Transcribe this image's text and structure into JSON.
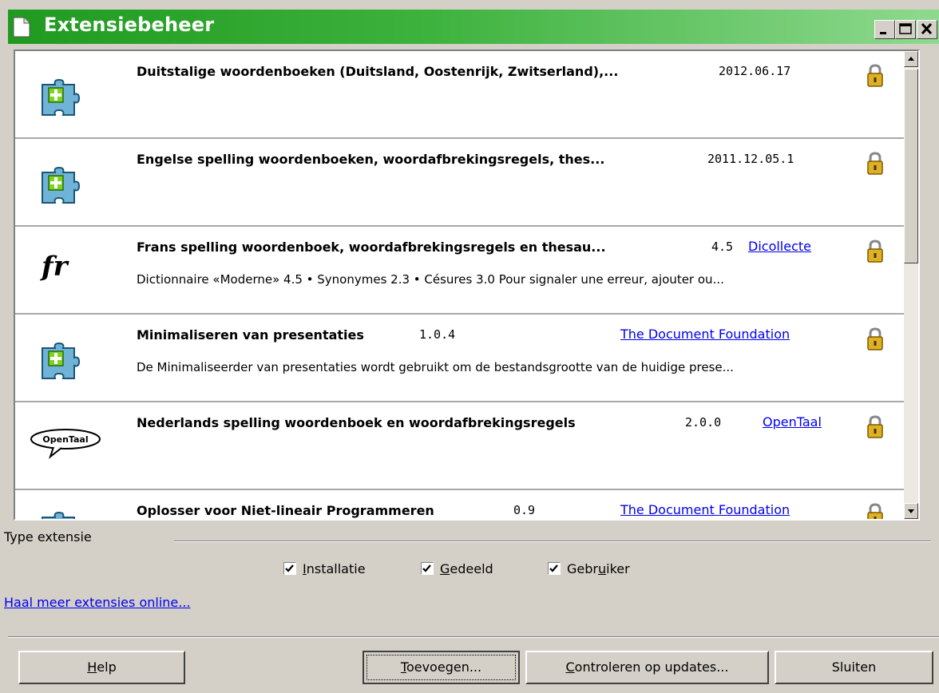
{
  "window": {
    "title": "Extensiebeheer",
    "title_gradient": [
      "#1f9a1f",
      "#8fd98f"
    ],
    "controls": [
      "minimize-icon",
      "maximize-icon",
      "close-icon"
    ]
  },
  "extensions": [
    {
      "name": "Duitstalige woordenboeken (Duitsland, Oostenrijk, Zwitserland),...",
      "version": "2012.06.17",
      "publisher": "",
      "description": "",
      "icon": "puzzle-icon",
      "locked": true
    },
    {
      "name": "Engelse spelling woordenboeken, woordafbrekingsregels, thes...",
      "version": "2011.12.05.1",
      "publisher": "",
      "description": "",
      "icon": "puzzle-icon",
      "locked": true
    },
    {
      "name": "Frans spelling woordenboek, woordafbrekingsregels en thesau...",
      "version": "4.5",
      "publisher": "Dicollecte",
      "description": "Dictionnaire «Moderne» 4.5 • Synonymes 2.3 • Césures 3.0  Pour signaler une erreur, ajouter ou...",
      "icon": "fr-icon",
      "icon_text": "fr",
      "locked": true
    },
    {
      "name": "Minimaliseren van presentaties",
      "version": "1.0.4",
      "publisher": "The Document Foundation",
      "description": "De Minimaliseerder van presentaties wordt gebruikt om de bestandsgrootte van de huidige prese...",
      "icon": "puzzle-icon",
      "locked": true
    },
    {
      "name": "Nederlands spelling woordenboek en woordafbrekingsregels",
      "version": "2.0.0",
      "publisher": "OpenTaal",
      "description": "",
      "icon": "opentaal-logo",
      "icon_text": "OpenTaal",
      "locked": true
    },
    {
      "name": "Oplosser voor Niet-lineair Programmeren",
      "version": "0.9",
      "publisher": "The Document Foundation",
      "description": "",
      "icon": "puzzle-icon",
      "locked": true
    }
  ],
  "filter": {
    "label": "Type extensie",
    "options": [
      {
        "label_pre": "",
        "label_u": "I",
        "label_post": "nstallatie",
        "checked": true
      },
      {
        "label_pre": "",
        "label_u": "G",
        "label_post": "edeeld",
        "checked": true
      },
      {
        "label_pre": "Gebr",
        "label_u": "u",
        "label_post": "iker",
        "checked": true
      }
    ]
  },
  "more_link": "Haal meer extensies online...",
  "buttons": {
    "help": {
      "u": "H",
      "rest": "elp"
    },
    "add": {
      "u": "T",
      "rest": "oevoegen..."
    },
    "updates": {
      "u": "C",
      "rest": "ontroleren op updates..."
    },
    "close": "Sluiten"
  },
  "colors": {
    "link": "#0000ee",
    "dialog_bg": "#d4d0c8",
    "puzzle_blue": "#6fb3d6",
    "puzzle_green": "#7ed321",
    "lock_gold": "#e0b020"
  }
}
